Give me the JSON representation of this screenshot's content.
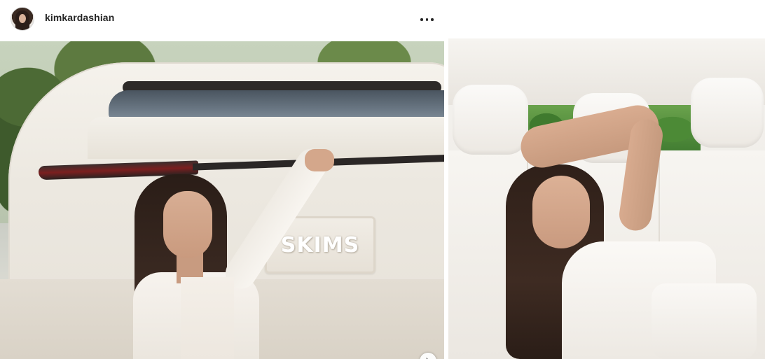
{
  "post": {
    "username": "kimkardashian",
    "more_icon": "more-horizontal-icon",
    "next_icon": "chevron-right-icon"
  },
  "media": {
    "left_photo": {
      "plate_text": "SKIMS"
    }
  },
  "colors": {
    "username": "#262626",
    "border": "#dbdbdb",
    "background": "#ffffff"
  }
}
